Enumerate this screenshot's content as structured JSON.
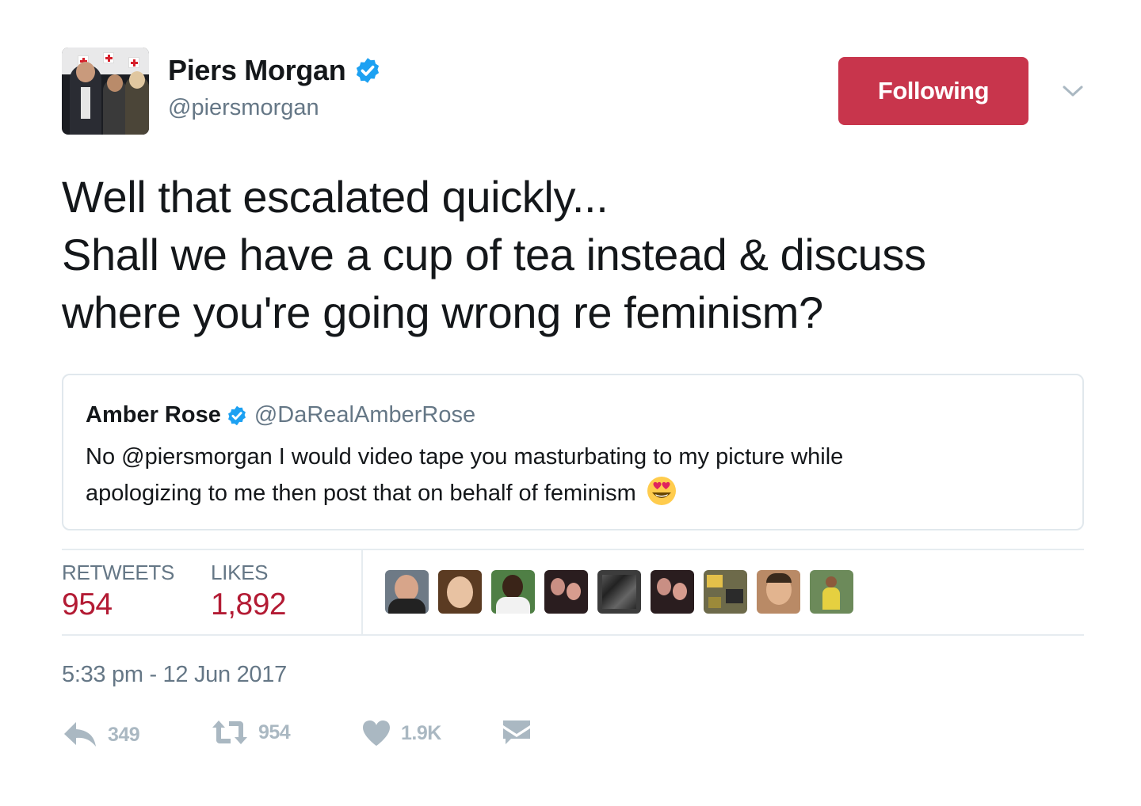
{
  "tweet": {
    "author": {
      "name": "Piers Morgan",
      "handle": "@piersmorgan",
      "verified": true
    },
    "follow_button_label": "Following",
    "text_lines": [
      "Well that escalated quickly...",
      "Shall we have a cup of tea instead & discuss",
      "where you're going wrong re feminism?"
    ],
    "quoted": {
      "name": "Amber Rose",
      "handle": "@DaRealAmberRose",
      "verified": true,
      "text_lines": [
        "No @piersmorgan I would video tape you masturbating to my picture while",
        "apologizing to me then post that on behalf of feminism"
      ],
      "trailing_emoji": "heart-eyes-emoji"
    },
    "stats": {
      "retweets_label": "RETWEETS",
      "retweets_value": "954",
      "likes_label": "LIKES",
      "likes_value": "1,892"
    },
    "timestamp": "5:33 pm - 12 Jun 2017",
    "actions": {
      "reply_count": "349",
      "retweet_count": "954",
      "like_count": "1.9K"
    }
  },
  "colors": {
    "follow_button": "#c8354c",
    "stat_value": "#b31b34",
    "verified_badge": "#1da1f2",
    "muted_text": "#657786",
    "action_icon": "#aab8c2"
  }
}
